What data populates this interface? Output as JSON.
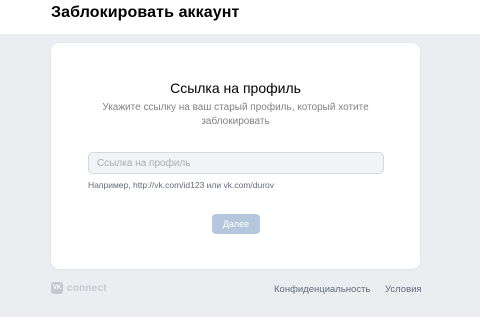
{
  "header": {
    "title": "Заблокировать аккаунт"
  },
  "card": {
    "title": "Ссылка на профиль",
    "subtitle": "Укажите ссылку на ваш старый профиль, который хотите заблокировать",
    "input": {
      "value": "",
      "placeholder": "Ссылка на профиль"
    },
    "hint": "Например, http://vk.com/id123 или vk.com/durov",
    "submit_label": "Далее"
  },
  "footer": {
    "brand_logo": "VK",
    "brand_text": "connect",
    "privacy_label": "Конфиденциальность",
    "terms_label": "Условия"
  },
  "colors": {
    "background": "#ebedf0",
    "button_disabled": "#b5c7dd",
    "muted_text": "#828282",
    "link_text": "#626d7a"
  }
}
